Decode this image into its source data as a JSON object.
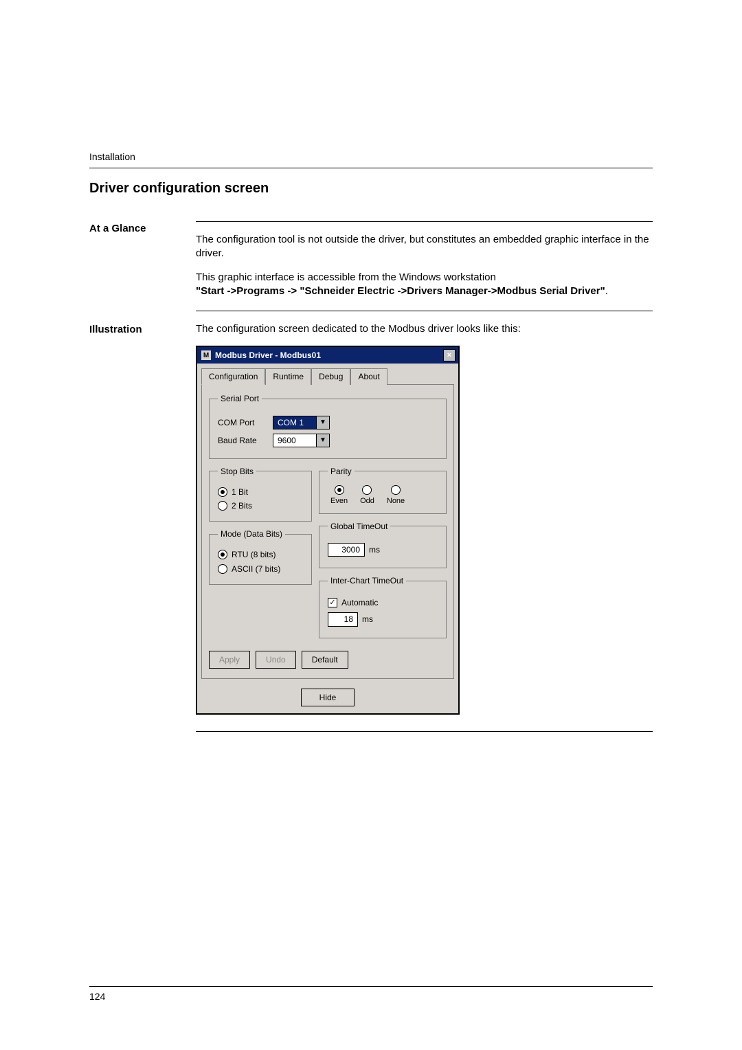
{
  "page": {
    "running_header": "Installation",
    "number": "124"
  },
  "section": {
    "title": "Driver configuration screen"
  },
  "glance": {
    "label": "At a Glance",
    "para1": "The configuration tool is not outside the driver, but constitutes an embedded graphic interface in the driver.",
    "para2a": "This graphic interface is accessible from the Windows workstation",
    "para2b": "\"Start ->Programs -> \"Schneider Electric ->Drivers Manager->Modbus Serial Driver\"",
    "para2c": "."
  },
  "illus": {
    "label": "Illustration",
    "caption": "The configuration screen dedicated to the Modbus driver looks like this:"
  },
  "dialog": {
    "title": "Modbus Driver - Modbus01",
    "tabs": {
      "configuration": "Configuration",
      "runtime": "Runtime",
      "debug": "Debug",
      "about": "About"
    },
    "serial": {
      "legend": "Serial Port",
      "com_label": "COM Port",
      "com_value": "COM 1",
      "baud_label": "Baud Rate",
      "baud_value": "9600"
    },
    "stopbits": {
      "legend": "Stop Bits",
      "opt1": "1 Bit",
      "opt2": "2 Bits"
    },
    "mode": {
      "legend": "Mode (Data Bits)",
      "opt1": "RTU (8 bits)",
      "opt2": "ASCII (7 bits)"
    },
    "parity": {
      "legend": "Parity",
      "even": "Even",
      "odd": "Odd",
      "none": "None"
    },
    "global_to": {
      "legend": "Global TimeOut",
      "value": "3000",
      "unit": "ms"
    },
    "ict": {
      "legend": "Inter-Chart TimeOut",
      "auto": "Automatic",
      "value": "18",
      "unit": "ms"
    },
    "buttons": {
      "apply": "Apply",
      "undo": "Undo",
      "default": "Default",
      "hide": "Hide"
    }
  }
}
